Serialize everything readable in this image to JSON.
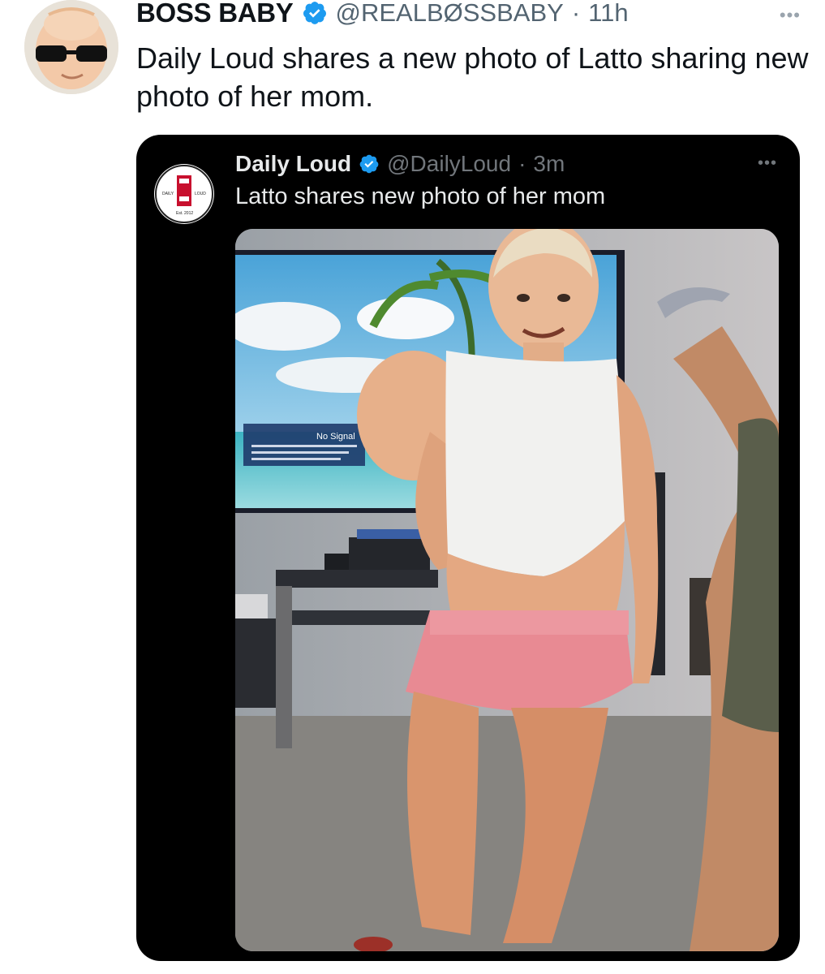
{
  "outer_tweet": {
    "display_name": "BOSS BABY",
    "handle": "@REALBØSSBABY",
    "separator": "·",
    "time": "11h",
    "text": "Daily Loud shares a new photo of Latto sharing new photo of her mom.",
    "more_icon": "more-horizontal-icon",
    "verified_icon": "verified-badge-icon"
  },
  "quoted_tweet": {
    "display_name": "Daily Loud",
    "handle": "@DailyLoud",
    "separator": "·",
    "time": "3m",
    "text": "Latto shares new photo of her mom",
    "more_icon": "more-horizontal-icon",
    "verified_icon": "verified-badge-icon",
    "logo_text": {
      "left": "DAILY",
      "right": "LOUD",
      "bottom": "Est. 2012"
    },
    "tv_screen_text": "No Signal"
  },
  "colors": {
    "verified_blue": "#1d9bf0",
    "card_background": "#000000",
    "logo_red": "#c8102e"
  }
}
